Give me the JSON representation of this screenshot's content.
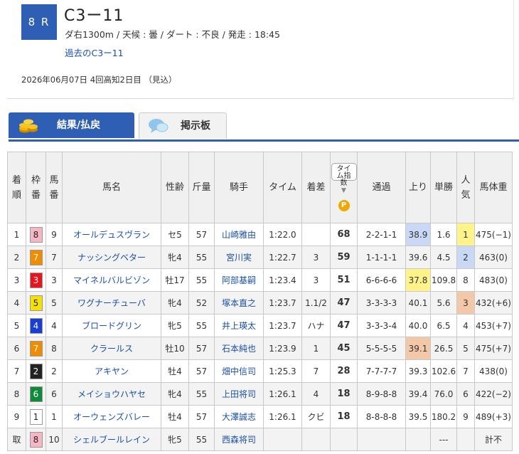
{
  "race": {
    "number": "8 R",
    "name": "C3ー11",
    "conditions": "ダ右1300m /  天候 : 曇 /  ダート : 不良  /  発走 : 18:45",
    "past_link": "過去のC3ー11",
    "date_line": "2026年06月07日 4回高知2日目 （見込）"
  },
  "tabs": [
    {
      "label": "結果/払戻",
      "active": true,
      "icon": "coins-icon"
    },
    {
      "label": "掲示板",
      "active": false,
      "icon": "chat-bubble-icon"
    }
  ],
  "headers": {
    "finish": "着順",
    "frame": "枠番",
    "horse_no": "馬番",
    "horse_name": "馬名",
    "sex_age": "性齢",
    "weight_carried": "斤量",
    "jockey": "騎手",
    "time": "タイム",
    "margin": "着差",
    "time_index": "タイム指数",
    "time_index_badge": "P",
    "passing": "通過",
    "last3f": "上り",
    "win_odds": "単勝",
    "popularity": "人気",
    "body_weight": "馬体重"
  },
  "colors": {
    "accent": "#2f5fb4",
    "frame_colors": {
      "1": "#ffffff",
      "2": "#222222",
      "3": "#e8141e",
      "4": "#1a3dd6",
      "5": "#f5e100",
      "6": "#0e8a3a",
      "7": "#f08c00",
      "8": "#f6b6c4"
    },
    "highlight_blue": "#c9d8f5",
    "highlight_yellow": "#fff38a",
    "highlight_orange": "#f2c8a8"
  },
  "rows": [
    {
      "finish": "1",
      "frame": "8",
      "horse_no": "9",
      "name": "オールデュスヴラン",
      "sex_age": "セ5",
      "weight": "57",
      "jockey": "山崎雅由",
      "time": "1:22.0",
      "margin": "",
      "index": "68",
      "passing": "2-2-1-1",
      "last3f": "38.9",
      "odds": "1.6",
      "pop": "1",
      "body": "475(−1)",
      "l3_hl": "blue",
      "pop_hl": "yellow"
    },
    {
      "finish": "2",
      "frame": "7",
      "horse_no": "7",
      "name": "ナッシングベター",
      "sex_age": "牝4",
      "weight": "55",
      "jockey": "宮川実",
      "time": "1:22.7",
      "margin": "3",
      "index": "59",
      "passing": "1-1-1-1",
      "last3f": "39.6",
      "odds": "4.5",
      "pop": "2",
      "body": "463(0)",
      "l3_hl": "",
      "pop_hl": "blue"
    },
    {
      "finish": "3",
      "frame": "3",
      "horse_no": "3",
      "name": "マイネルバルビゾン",
      "sex_age": "牡17",
      "weight": "55",
      "jockey": "阿部基嗣",
      "time": "1:23.4",
      "margin": "3",
      "index": "51",
      "passing": "6-6-6-6",
      "last3f": "37.8",
      "odds": "109.8",
      "pop": "8",
      "body": "483(0)",
      "l3_hl": "yellow",
      "pop_hl": ""
    },
    {
      "finish": "4",
      "frame": "5",
      "horse_no": "5",
      "name": "ワグナーチューバ",
      "sex_age": "牝4",
      "weight": "52",
      "jockey": "塚本直之",
      "time": "1:23.7",
      "margin": "1.1/2",
      "index": "47",
      "passing": "3-3-3-3",
      "last3f": "40.1",
      "odds": "5.6",
      "pop": "3",
      "body": "432(+6)",
      "l3_hl": "",
      "pop_hl": "orange"
    },
    {
      "finish": "5",
      "frame": "4",
      "horse_no": "4",
      "name": "ブロードグリン",
      "sex_age": "牝5",
      "weight": "55",
      "jockey": "井上瑛太",
      "time": "1:23.7",
      "margin": "ハナ",
      "index": "47",
      "passing": "3-3-3-4",
      "last3f": "40.0",
      "odds": "6.5",
      "pop": "4",
      "body": "453(+7)",
      "l3_hl": "",
      "pop_hl": ""
    },
    {
      "finish": "6",
      "frame": "7",
      "horse_no": "8",
      "name": "クラールス",
      "sex_age": "牡10",
      "weight": "57",
      "jockey": "石本純也",
      "time": "1:23.9",
      "margin": "1",
      "index": "45",
      "passing": "5-5-5-5",
      "last3f": "39.1",
      "odds": "26.5",
      "pop": "5",
      "body": "475(+7)",
      "l3_hl": "orange",
      "pop_hl": ""
    },
    {
      "finish": "7",
      "frame": "2",
      "horse_no": "2",
      "name": "アキヤン",
      "sex_age": "牡4",
      "weight": "57",
      "jockey": "畑中信司",
      "time": "1:25.3",
      "margin": "7",
      "index": "28",
      "passing": "7-7-7-7",
      "last3f": "39.3",
      "odds": "102.6",
      "pop": "7",
      "body": "438(0)",
      "l3_hl": "",
      "pop_hl": ""
    },
    {
      "finish": "8",
      "frame": "6",
      "horse_no": "6",
      "name": "メイショウハヤセ",
      "sex_age": "牝4",
      "weight": "55",
      "jockey": "上田将司",
      "time": "1:26.1",
      "margin": "4",
      "index": "18",
      "passing": "8-9-8-8",
      "last3f": "39.4",
      "odds": "76.0",
      "pop": "6",
      "body": "422(−2)",
      "l3_hl": "",
      "pop_hl": ""
    },
    {
      "finish": "9",
      "frame": "1",
      "horse_no": "1",
      "name": "オーウェンズバレー",
      "sex_age": "牡4",
      "weight": "57",
      "jockey": "大澤誠志",
      "time": "1:26.1",
      "margin": "クビ",
      "index": "18",
      "passing": "8-8-8-8",
      "last3f": "39.5",
      "odds": "180.2",
      "pop": "9",
      "body": "489(+3)",
      "l3_hl": "",
      "pop_hl": ""
    },
    {
      "finish": "取",
      "frame": "8",
      "horse_no": "10",
      "name": "シェルブールレイン",
      "sex_age": "牝5",
      "weight": "55",
      "jockey": "西森将司",
      "time": "",
      "margin": "",
      "index": "",
      "passing": "",
      "last3f": "",
      "odds": "---",
      "pop": "",
      "body": "計不",
      "l3_hl": "",
      "pop_hl": ""
    }
  ]
}
